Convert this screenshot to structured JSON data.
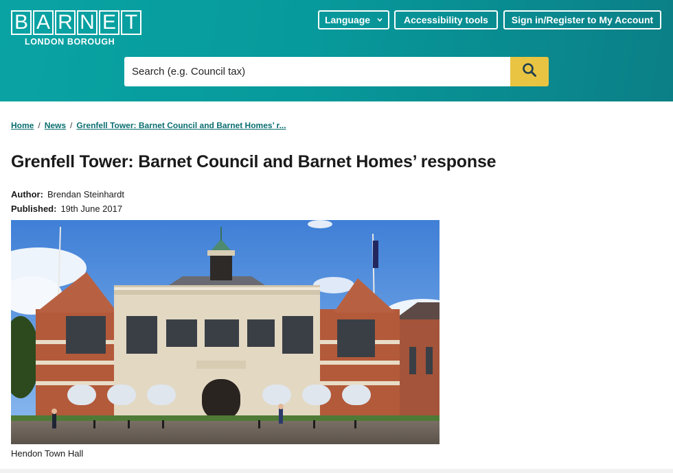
{
  "logo": {
    "letters": [
      "B",
      "A",
      "R",
      "N",
      "E",
      "T"
    ],
    "subtitle": "LONDON BOROUGH"
  },
  "header": {
    "language_label": "Language",
    "accessibility_label": "Accessibility tools",
    "sign_in_label": "Sign in/Register to My Account"
  },
  "search": {
    "placeholder": "Search (e.g. Council tax)"
  },
  "breadcrumb": {
    "home": "Home",
    "news": "News",
    "current": "Grenfell Tower: Barnet Council and Barnet Homes’ r..."
  },
  "article": {
    "title": "Grenfell Tower: Barnet Council and Barnet Homes’ response",
    "author_label": "Author:",
    "author": "Brendan Steinhardt",
    "published_label": "Published:",
    "published": "19th June 2017",
    "image_caption": "Hendon Town Hall"
  },
  "colors": {
    "header_teal": "#0aa3a3",
    "search_button": "#e9c443",
    "link": "#0a6e70"
  },
  "icons": {
    "search": "search-icon",
    "language_dropdown": "chevron-down-icon"
  }
}
